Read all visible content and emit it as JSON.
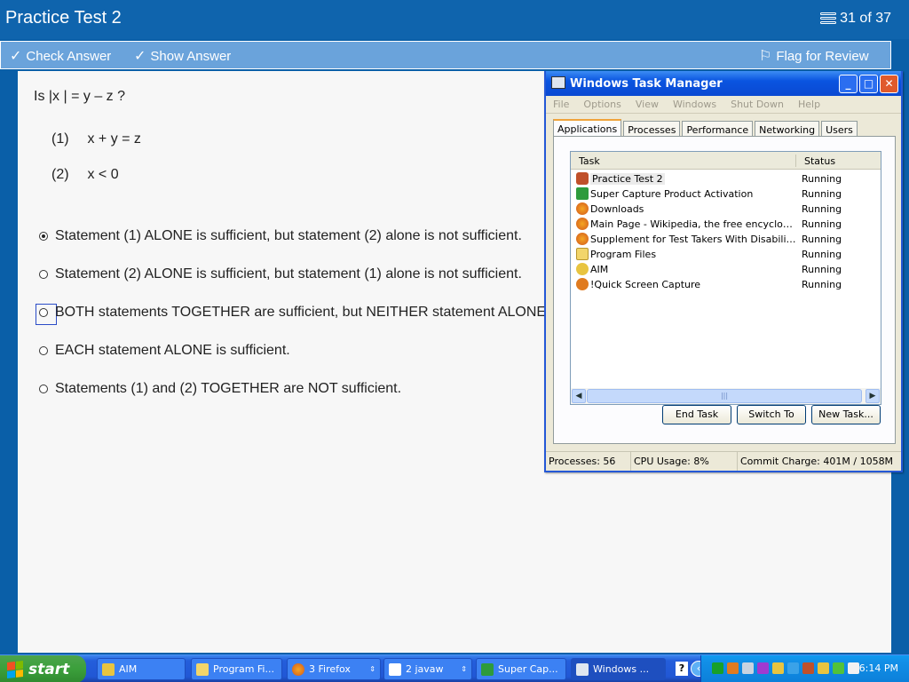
{
  "app": {
    "title": "Practice Test 2",
    "progress": "31 of 37",
    "check_answer": "Check Answer",
    "show_answer": "Show Answer",
    "flag_review": "Flag for Review"
  },
  "question": {
    "stem": "Is |x | = y – z ?",
    "statements": [
      {
        "num": "(1)",
        "text": "x + y = z"
      },
      {
        "num": "(2)",
        "text": "x < 0"
      }
    ],
    "choices": [
      {
        "text": "Statement (1) ALONE is sufficient, but statement (2) alone is not sufficient.",
        "selected": true
      },
      {
        "text": "Statement (2) ALONE is sufficient, but statement (1) alone is not sufficient.",
        "selected": false
      },
      {
        "text": "BOTH statements TOGETHER are sufficient, but NEITHER statement ALONE is sufficient.",
        "selected": false
      },
      {
        "text": "EACH statement ALONE is sufficient.",
        "selected": false
      },
      {
        "text": "Statements (1) and (2) TOGETHER are NOT sufficient.",
        "selected": false
      }
    ]
  },
  "taskmgr": {
    "title": "Windows Task Manager",
    "menu": [
      "File",
      "Options",
      "View",
      "Windows",
      "Shut Down",
      "Help"
    ],
    "tabs": [
      "Applications",
      "Processes",
      "Performance",
      "Networking",
      "Users"
    ],
    "active_tab": "Applications",
    "col_task": "Task",
    "col_status": "Status",
    "rows": [
      {
        "task": "Practice Test 2",
        "status": "Running",
        "icon": "java-icon"
      },
      {
        "task": "Super Capture Product Activation",
        "status": "Running",
        "icon": "arrow-app-icon"
      },
      {
        "task": "Downloads",
        "status": "Running",
        "icon": "firefox-icon"
      },
      {
        "task": "Main Page - Wikipedia, the free encyclopedia ...",
        "status": "Running",
        "icon": "firefox-icon"
      },
      {
        "task": "Supplement for Test Takers With Disabilities - ...",
        "status": "Running",
        "icon": "firefox-icon"
      },
      {
        "task": "Program Files",
        "status": "Running",
        "icon": "folder-icon"
      },
      {
        "task": "AIM",
        "status": "Running",
        "icon": "aim-icon"
      },
      {
        "task": "!Quick Screen Capture",
        "status": "Running",
        "icon": "capture-icon"
      }
    ],
    "buttons": {
      "end_task": "End Task",
      "switch_to": "Switch To",
      "new_task": "New Task..."
    },
    "status": {
      "processes": "Processes: 56",
      "cpu": "CPU Usage: 8%",
      "commit": "Commit Charge: 401M / 1058M"
    }
  },
  "taskbar": {
    "start": "start",
    "items": [
      "AIM",
      "Program Fi...",
      "3 Firefox",
      "2 javaw",
      "Super Cap...",
      "Windows ..."
    ],
    "clock": "6:14 PM",
    "help": "?"
  },
  "colors": {
    "title_blue": "#0f64ad",
    "toolbar": "#6aa3db",
    "xp_blue": "#245edb",
    "start_green": "#3b9f3b"
  }
}
